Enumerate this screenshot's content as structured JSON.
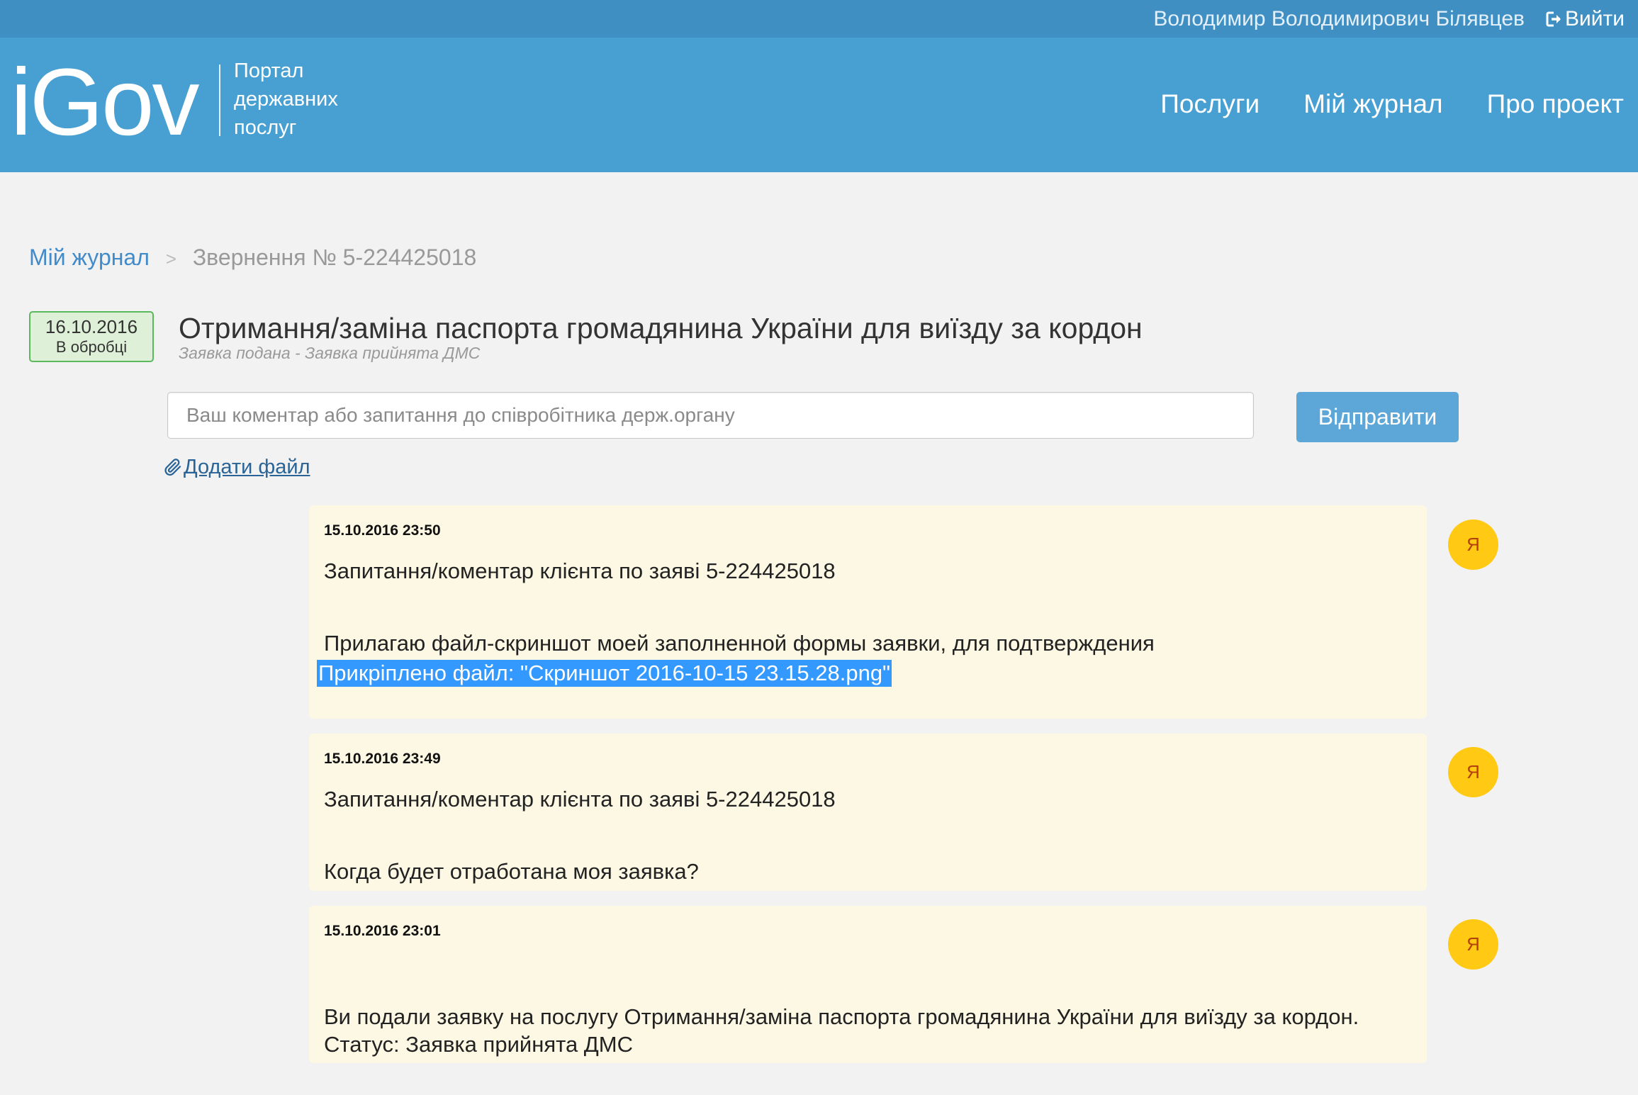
{
  "topbar": {
    "user_name": "Володимир Володимирович Білявцев",
    "logout_label": "Вийти",
    "logout_icon": "logout-icon"
  },
  "header": {
    "logo": "iGov",
    "tagline": [
      "Портал",
      "державних",
      "послуг"
    ],
    "nav": [
      {
        "label": "Послуги"
      },
      {
        "label": "Мій журнал"
      },
      {
        "label": "Про проект"
      }
    ]
  },
  "breadcrumb": {
    "home": "Мій журнал",
    "separator": ">",
    "current": "Звернення № 5-224425018"
  },
  "order": {
    "date": "16.10.2016",
    "status": "В обробці",
    "title": "Отримання/заміна паспорта громадянина України для виїзду за кордон",
    "subtitle": "Заявка подана - Заявка прийнята ДМС"
  },
  "comment_form": {
    "placeholder": "Ваш коментар або запитання до співробітника держ.органу",
    "value": "",
    "submit_label": "Відправити",
    "attach_label": "Додати файл",
    "attach_icon": "paperclip-icon"
  },
  "messages": [
    {
      "date": "15.10.2016 23:50",
      "title": "Запитання/коментар клієнта по заяві 5-224425018",
      "body": [
        "Прилагаю файл-скриншот моей заполненной формы заявки, для подтверждения"
      ],
      "attachment": "Прикріплено файл: \"Скриншот 2016-10-15 23.15.28.png\"",
      "avatar": "Я"
    },
    {
      "date": "15.10.2016 23:49",
      "title": "Запитання/коментар клієнта по заяві 5-224425018",
      "body": [
        "Когда будет отработана моя заявка?"
      ],
      "avatar": "Я"
    },
    {
      "date": "15.10.2016 23:01",
      "body": [
        "Ви подали заявку на послугу Отримання/заміна паспорта громадянина України для виїзду за кордон.",
        "Статус: Заявка прийнята ДМС"
      ],
      "avatar": "Я"
    }
  ],
  "colors": {
    "topbar": "#3f8fc3",
    "header": "#489fd2",
    "link": "#428bca",
    "status_badge_border": "#5cb85c",
    "status_badge_bg": "#dff0d8",
    "send_button": "#5ca7d8",
    "message_bg": "#fdf8e3",
    "avatar_bg": "#ffc914",
    "text_selection": "#3399ff"
  }
}
